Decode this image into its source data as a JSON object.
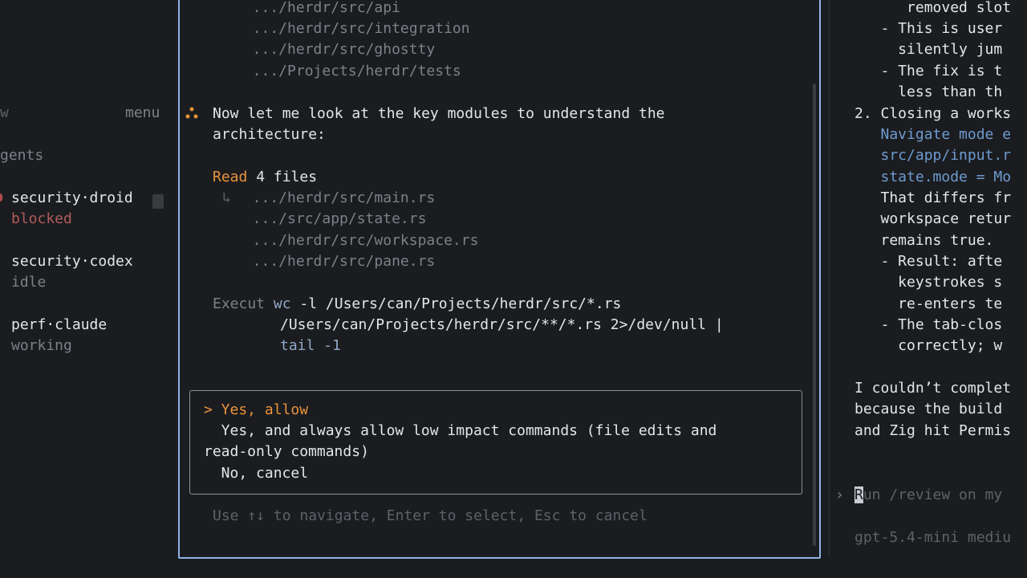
{
  "sidebar": {
    "header_left": "w",
    "menu_label": "menu",
    "section_label": "gents",
    "agents": [
      {
        "name": "security·droid",
        "status": "blocked",
        "status_color": "#a0504f"
      },
      {
        "name": "security·codex",
        "status": "idle",
        "status_color": "#7d8088"
      },
      {
        "name": "perf·claude",
        "status": "working",
        "status_color": "#7d8088"
      }
    ]
  },
  "center": {
    "paths_top": [
      "  .../herdr/src/api",
      "  .../herdr/src/integration",
      "  .../herdr/src/ghostty",
      "  .../Projects/herdr/tests"
    ],
    "message_icon": "spinner-icon",
    "message_line1": "Now let me look at the key modules to understand the",
    "message_line2": "architecture:",
    "read_label": "Read",
    "read_count": "4 files",
    "read_branch": "↳",
    "read_files": [
      "  .../herdr/src/main.rs",
      "  .../src/app/state.rs",
      "  .../herdr/src/workspace.rs",
      "  .../herdr/src/pane.rs"
    ],
    "execute_label": "Execut",
    "exec_cmd": "wc",
    "exec_line1": " -l /Users/can/Projects/herdr/src/*.rs",
    "exec_line2": "/Users/can/Projects/herdr/src/**/*.rs 2>/dev/null |",
    "exec_line3": "tail -1",
    "dialog": {
      "option1": "> Yes, allow",
      "option2a": "  Yes, and always allow low impact commands (file edits and",
      "option2b": "read-only commands)",
      "option3": "  No, cancel"
    },
    "hint": "Use ↑↓ to navigate, Enter to select, Esc to cancel"
  },
  "right": {
    "lines": [
      "      removed slot",
      "   - This is user",
      "     silently jum",
      "   - The fix is t",
      "     less than th",
      "2. Closing a works",
      "   Navigate mode e",
      "   src/app/input.r",
      "   state.mode = Mo",
      "   That differs fr",
      "   workspace retur",
      "   remains true.",
      "   - Result: afte",
      "     keystrokes s",
      "     re-enters te",
      "   - The tab-clos",
      "     correctly; w",
      "",
      "I couldn’t complet",
      "because the build",
      "and Zig hit Permis"
    ],
    "prompt_arrow": "›",
    "prompt_cursor": "R",
    "prompt_text": "un /review on my",
    "model_line": "gpt-5.4-mini mediu"
  }
}
